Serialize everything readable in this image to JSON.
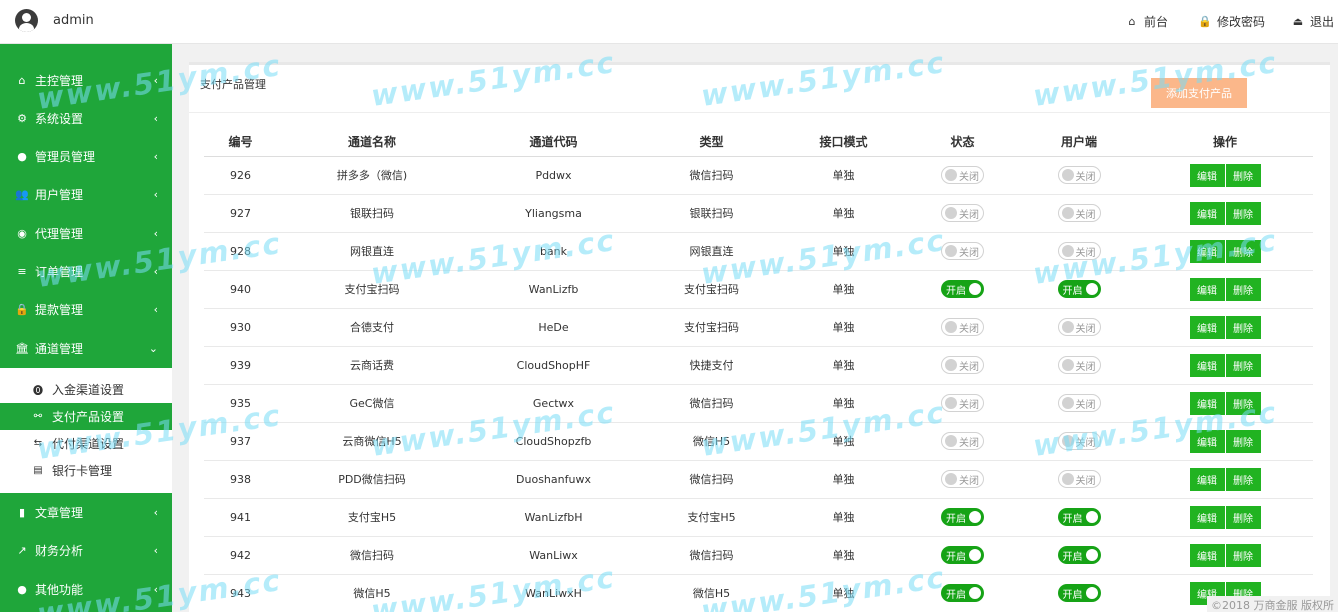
{
  "header": {
    "username": "admin",
    "links": [
      {
        "label": "前台",
        "icon": "home-icon",
        "glyph": "⌂"
      },
      {
        "label": "修改密码",
        "icon": "lock-icon",
        "glyph": "🔒"
      },
      {
        "label": "退出",
        "icon": "logout-icon",
        "glyph": "⏏"
      }
    ]
  },
  "sidebar": {
    "items": [
      {
        "label": "主控管理",
        "icon": "home-icon",
        "glyph": "⌂",
        "chevron": "‹"
      },
      {
        "label": "系统设置",
        "icon": "gear-icon",
        "glyph": "⚙",
        "chevron": "‹"
      },
      {
        "label": "管理员管理",
        "icon": "user-circle-icon",
        "glyph": "●",
        "chevron": "‹"
      },
      {
        "label": "用户管理",
        "icon": "users-icon",
        "glyph": "👥",
        "chevron": "‹"
      },
      {
        "label": "代理管理",
        "icon": "eye-icon",
        "glyph": "◉",
        "chevron": "‹"
      },
      {
        "label": "订单管理",
        "icon": "list-icon",
        "glyph": "≡",
        "chevron": "‹"
      },
      {
        "label": "提款管理",
        "icon": "lock-icon",
        "glyph": "🔒",
        "chevron": "‹"
      },
      {
        "label": "通道管理",
        "icon": "bank-icon",
        "glyph": "🏛",
        "chevron": "⌄"
      },
      {
        "label": "文章管理",
        "icon": "book-icon",
        "glyph": "▮",
        "chevron": "‹"
      },
      {
        "label": "财务分析",
        "icon": "chart-icon",
        "glyph": "↗",
        "chevron": "‹"
      },
      {
        "label": "其他功能",
        "icon": "user-circle-icon",
        "glyph": "●",
        "chevron": "‹"
      }
    ],
    "subitems": [
      {
        "label": "入金渠道设置",
        "icon": "coin-icon",
        "glyph": "⓿"
      },
      {
        "label": "支付产品设置",
        "icon": "sitemap-icon",
        "glyph": "⚯"
      },
      {
        "label": "代付渠道设置",
        "icon": "exchange-icon",
        "glyph": "⇆"
      },
      {
        "label": "银行卡管理",
        "icon": "card-icon",
        "glyph": "▤"
      }
    ]
  },
  "panel": {
    "title": "支付产品管理",
    "add_button": "添加支付产品"
  },
  "table": {
    "headers": [
      "编号",
      "通道名称",
      "通道代码",
      "类型",
      "接口模式",
      "状态",
      "用户端",
      "操作"
    ],
    "on_label": "开启",
    "off_label": "关闭",
    "edit_label": "编辑",
    "delete_label": "删除",
    "rows": [
      {
        "id": "926",
        "name": "拼多多（微信)",
        "code": "Pddwx",
        "type": "微信扫码",
        "mode": "单独",
        "status": false,
        "client": false
      },
      {
        "id": "927",
        "name": "银联扫码",
        "code": "Yliangsma",
        "type": "银联扫码",
        "mode": "单独",
        "status": false,
        "client": false
      },
      {
        "id": "928",
        "name": "网银直连",
        "code": "bank",
        "type": "网银直连",
        "mode": "单独",
        "status": false,
        "client": false
      },
      {
        "id": "940",
        "name": "支付宝扫码",
        "code": "WanLizfb",
        "type": "支付宝扫码",
        "mode": "单独",
        "status": true,
        "client": true
      },
      {
        "id": "930",
        "name": "合德支付",
        "code": "HeDe",
        "type": "支付宝扫码",
        "mode": "单独",
        "status": false,
        "client": false
      },
      {
        "id": "939",
        "name": "云商话费",
        "code": "CloudShopHF",
        "type": "快捷支付",
        "mode": "单独",
        "status": false,
        "client": false
      },
      {
        "id": "935",
        "name": "GeC微信",
        "code": "Gectwx",
        "type": "微信扫码",
        "mode": "单独",
        "status": false,
        "client": false
      },
      {
        "id": "937",
        "name": "云商微信H5",
        "code": "CloudShopzfb",
        "type": "微信H5",
        "mode": "单独",
        "status": false,
        "client": false
      },
      {
        "id": "938",
        "name": "PDD微信扫码",
        "code": "Duoshanfuwx",
        "type": "微信扫码",
        "mode": "单独",
        "status": false,
        "client": false
      },
      {
        "id": "941",
        "name": "支付宝H5",
        "code": "WanLizfbH",
        "type": "支付宝H5",
        "mode": "单独",
        "status": true,
        "client": true
      },
      {
        "id": "942",
        "name": "微信扫码",
        "code": "WanLiwx",
        "type": "微信扫码",
        "mode": "单独",
        "status": true,
        "client": true
      },
      {
        "id": "943",
        "name": "微信H5",
        "code": "WanLiwxH",
        "type": "微信H5",
        "mode": "单独",
        "status": true,
        "client": true
      }
    ]
  },
  "footer": "©2018 万商金服 版权所",
  "watermark": "www.51ym.cc"
}
